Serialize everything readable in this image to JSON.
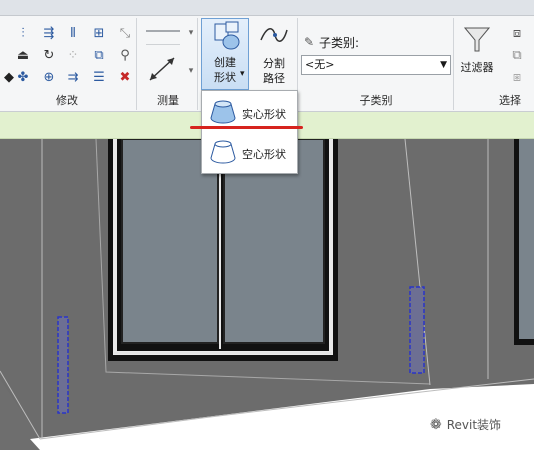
{
  "ribbon": {
    "panels": {
      "modify": "修改",
      "measure": "测量",
      "subcategory": "子类别",
      "select": "选择"
    },
    "create_shape": {
      "line1": "创建",
      "line2": "形状"
    },
    "split_path": {
      "line1": "分割",
      "line2": "路径"
    },
    "subcategory_label": "子类别:",
    "subcategory_value": "<无>",
    "filter_label": "过滤器"
  },
  "dropdown": {
    "solid_label": "实心形状",
    "void_label": "空心形状"
  },
  "watermark": {
    "text": "Revit装饰"
  },
  "colors": {
    "accent_blue": "#6fa0d4",
    "highlight_red": "#d6231e",
    "status_green": "#e2f1cf",
    "viewport_gray": "#6c6c6c"
  }
}
